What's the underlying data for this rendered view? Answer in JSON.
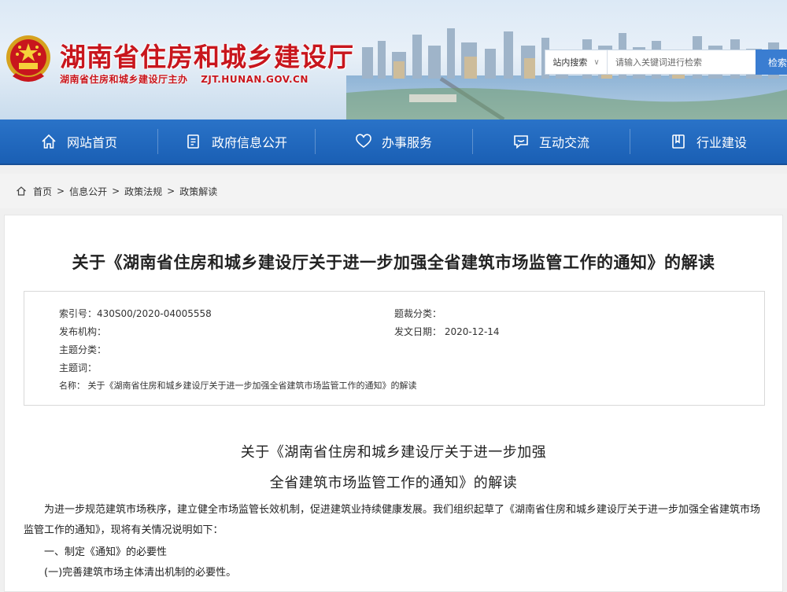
{
  "header": {
    "title": "湖南省住房和城乡建设厅",
    "subtitle": "湖南省住房和城乡建设厅主办",
    "domain": "ZJT.HUNAN.GOV.CN"
  },
  "search": {
    "scope_label": "站内搜索",
    "placeholder": "请输入关键词进行检索",
    "button_label": "检索"
  },
  "nav": {
    "items": [
      {
        "label": "网站首页",
        "icon": "home-icon"
      },
      {
        "label": "政府信息公开",
        "icon": "document-icon"
      },
      {
        "label": "办事服务",
        "icon": "heart-icon"
      },
      {
        "label": "互动交流",
        "icon": "chat-icon"
      },
      {
        "label": "行业建设",
        "icon": "book-icon"
      }
    ]
  },
  "breadcrumb": {
    "items": [
      "首页",
      "信息公开",
      "政策法规",
      "政策解读"
    ],
    "separator": ">"
  },
  "article": {
    "title": "关于《湖南省住房和城乡建设厅关于进一步加强全省建筑市场监管工作的通知》的解读",
    "meta": {
      "index_no": "索引号：430S00/2020-04005558",
      "category": "题裁分类：",
      "publisher": "发布机构：",
      "issue_date": "发文日期： 2020-12-14",
      "topic_category": "主题分类：",
      "topic_words": "主题词：",
      "name": "名称： 关于《湖南省住房和城乡建设厅关于进一步加强全省建筑市场监管工作的通知》的解读"
    },
    "doc_title_line1": "关于《湖南省住房和城乡建设厅关于进一步加强",
    "doc_title_line2": "全省建筑市场监管工作的通知》的解读",
    "paragraphs": [
      "为进一步规范建筑市场秩序，建立健全市场监管长效机制，促进建筑业持续健康发展。我们组织起草了《湖南省住房和城乡建设厅关于进一步加强全省建筑市场监管工作的通知》，现将有关情况说明如下：",
      "一、制定《通知》的必要性",
      "(一)完善建筑市场主体清出机制的必要性。"
    ]
  },
  "colors": {
    "brand_red": "#c8161d",
    "nav_blue": "#1a5fb4",
    "search_button": "#3a7dd1"
  }
}
